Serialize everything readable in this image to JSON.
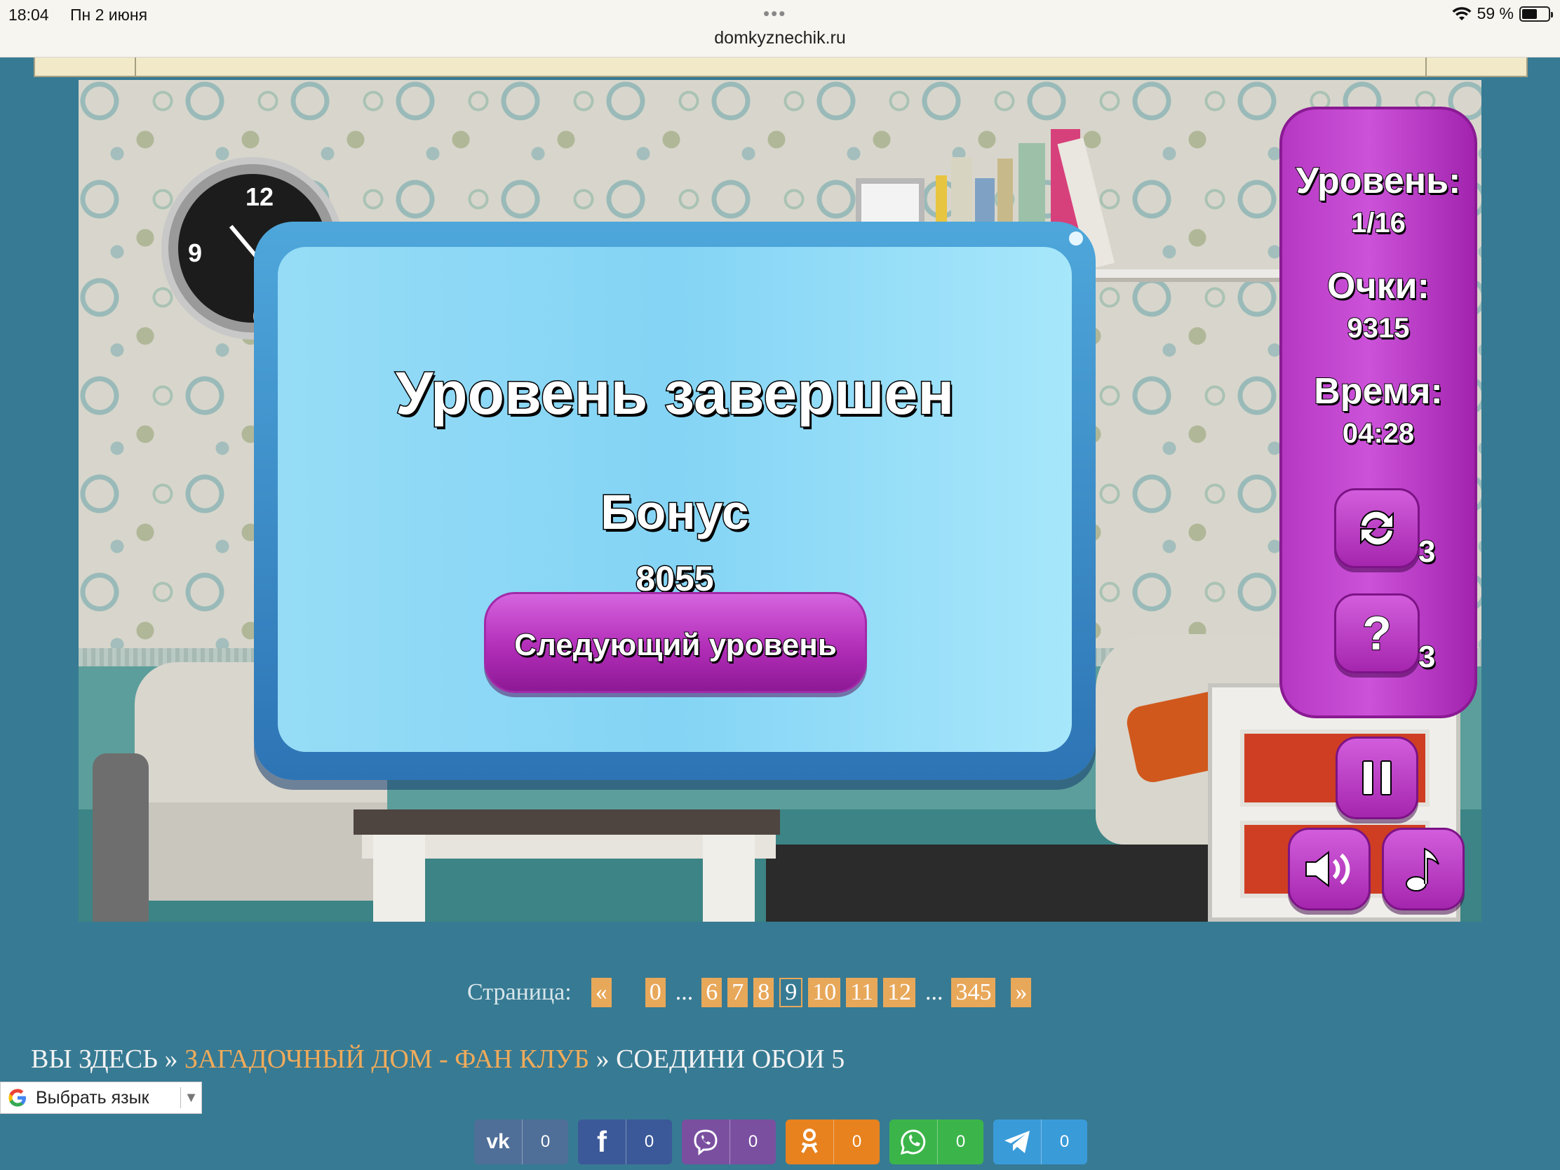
{
  "status_bar": {
    "time": "18:04",
    "date": "Пн 2 июня",
    "battery": "59 %",
    "battery_level": 0.59,
    "icons": [
      "wifi-icon",
      "battery-icon"
    ]
  },
  "browser": {
    "url": "domkyznechik.ru",
    "menu_dots": "•••"
  },
  "game": {
    "dialog": {
      "title": "Уровень завершен",
      "bonus_label": "Бонус",
      "bonus_value": "8055",
      "next_button": "Следующий уровень"
    },
    "hud": {
      "level_label": "Уровень:",
      "level_value": "1/16",
      "score_label": "Очки:",
      "score_value": "9315",
      "time_label": "Время:",
      "time_value": "04:28",
      "shuffle_icon": "shuffle-icon",
      "shuffle_count": "3",
      "hint_icon": "question-icon",
      "hint_glyph": "?",
      "hint_count": "3",
      "pause_icon": "pause-icon",
      "sound_icon": "speaker-icon",
      "music_icon": "music-note-icon"
    }
  },
  "pagination": {
    "label": "Страница:",
    "prev": "«",
    "next": "»",
    "pages_before": [
      "0"
    ],
    "ellipsis": "...",
    "pages_middle": [
      "6",
      "7",
      "8"
    ],
    "current": "9",
    "pages_after": [
      "10",
      "11",
      "12"
    ],
    "last": "345"
  },
  "breadcrumb": {
    "prefix": "ВЫ ЗДЕСЬ",
    "separator": "»",
    "link": "ЗАГАДОЧНЫЙ ДОМ - ФАН КЛУБ",
    "current": "СОЕДИНИ ОБОИ 5"
  },
  "translate": {
    "label": "Выбрать язык",
    "arrow": "▼"
  },
  "share": [
    {
      "network": "vk",
      "icon": "vk-icon",
      "glyph": "vk",
      "count": "0",
      "color": "#4f6f98"
    },
    {
      "network": "facebook",
      "icon": "facebook-icon",
      "glyph": "f",
      "count": "0",
      "color": "#3b5998"
    },
    {
      "network": "viber",
      "icon": "viber-icon",
      "glyph": "",
      "count": "0",
      "color": "#7a4fa0"
    },
    {
      "network": "odnoklassniki",
      "icon": "odnoklassniki-icon",
      "glyph": "",
      "count": "0",
      "color": "#e8821e"
    },
    {
      "network": "whatsapp",
      "icon": "whatsapp-icon",
      "glyph": "",
      "count": "0",
      "color": "#3bb54a"
    },
    {
      "network": "telegram",
      "icon": "telegram-icon",
      "glyph": "",
      "count": "0",
      "color": "#3a9bd9"
    }
  ]
}
